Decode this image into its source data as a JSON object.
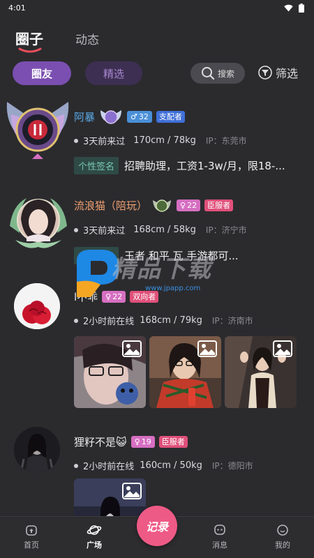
{
  "status_bar": {
    "time": "4:01"
  },
  "header": {
    "tab_active": "圈子",
    "tab_other": "动态"
  },
  "filters": {
    "tab_active": "圈友",
    "tab_other": "精选",
    "search_label": "搜索",
    "filter_label": "筛选"
  },
  "posts": [
    {
      "username": "阿暴",
      "username_color": "#5aa9e6",
      "level": "32",
      "level_symbol": "♂",
      "level_color": "#4a8fd8",
      "role": "支配者",
      "role_color": "#3f6fd8",
      "last_seen": "3天前来过",
      "stats": "170cm / 78kg",
      "ip": "IP：东莞市",
      "signature_label": "个性签名",
      "signature": "招聘助理，工资1-3w/月，限18-..."
    },
    {
      "username": "流浪猫（陪玩）",
      "username_color": "#f0a070",
      "level": "22",
      "level_symbol": "♀",
      "level_color": "#d66fc2",
      "role": "臣服者",
      "role_color": "#e0507a",
      "last_seen": "3天前来过",
      "stats": "168cm / 58kg",
      "ip": "IP：济宁市",
      "signature_label": "个性签名",
      "signature": "王者 和平 瓦 手游都可..."
    },
    {
      "username": "l不乖",
      "username_color": "#e8e8ea",
      "level": "22",
      "level_symbol": "♀",
      "level_color": "#d66fc2",
      "role": "双向者",
      "role_color": "#e0507a",
      "last_seen": "2小时前在线",
      "stats": "168cm / 79kg",
      "ip": "IP：济南市"
    },
    {
      "username": "狸籽不是😺",
      "username_color": "#e8e8ea",
      "level": "19",
      "level_symbol": "♀",
      "level_color": "#d66fc2",
      "role": "臣服者",
      "role_color": "#e0507a",
      "last_seen": "2小时前在线",
      "stats": "160cm / 50kg",
      "ip": "IP：德阳市"
    }
  ],
  "watermark": {
    "text": "精品下载",
    "url": "www.jpapp.com"
  },
  "bottom_nav": {
    "home": "首页",
    "square": "广场",
    "record": "记录",
    "messages": "消息",
    "mine": "我的"
  }
}
